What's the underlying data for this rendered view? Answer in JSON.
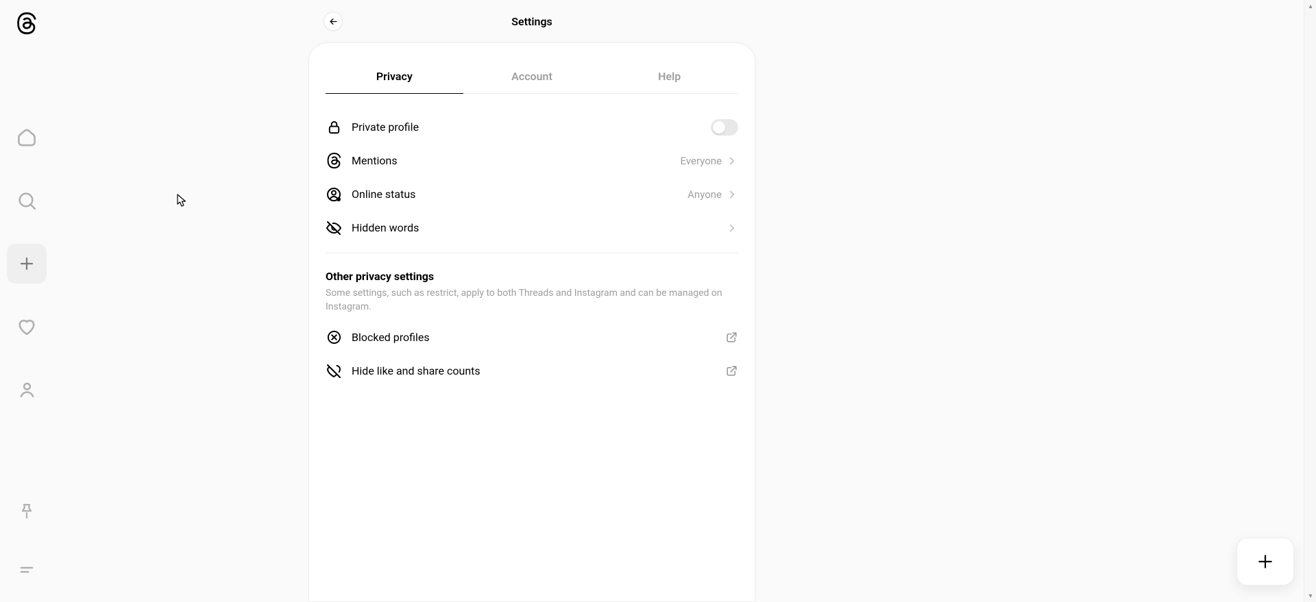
{
  "header": {
    "title": "Settings"
  },
  "tabs": {
    "privacy": "Privacy",
    "account": "Account",
    "help": "Help"
  },
  "rows": {
    "private_profile": "Private profile",
    "mentions": "Mentions",
    "mentions_value": "Everyone",
    "online_status": "Online status",
    "online_status_value": "Anyone",
    "hidden_words": "Hidden words"
  },
  "section": {
    "title": "Other privacy settings",
    "desc": "Some settings, such as restrict, apply to both Threads and Instagram and can be managed on Instagram."
  },
  "external": {
    "blocked_profiles": "Blocked profiles",
    "hide_counts": "Hide like and share counts"
  }
}
